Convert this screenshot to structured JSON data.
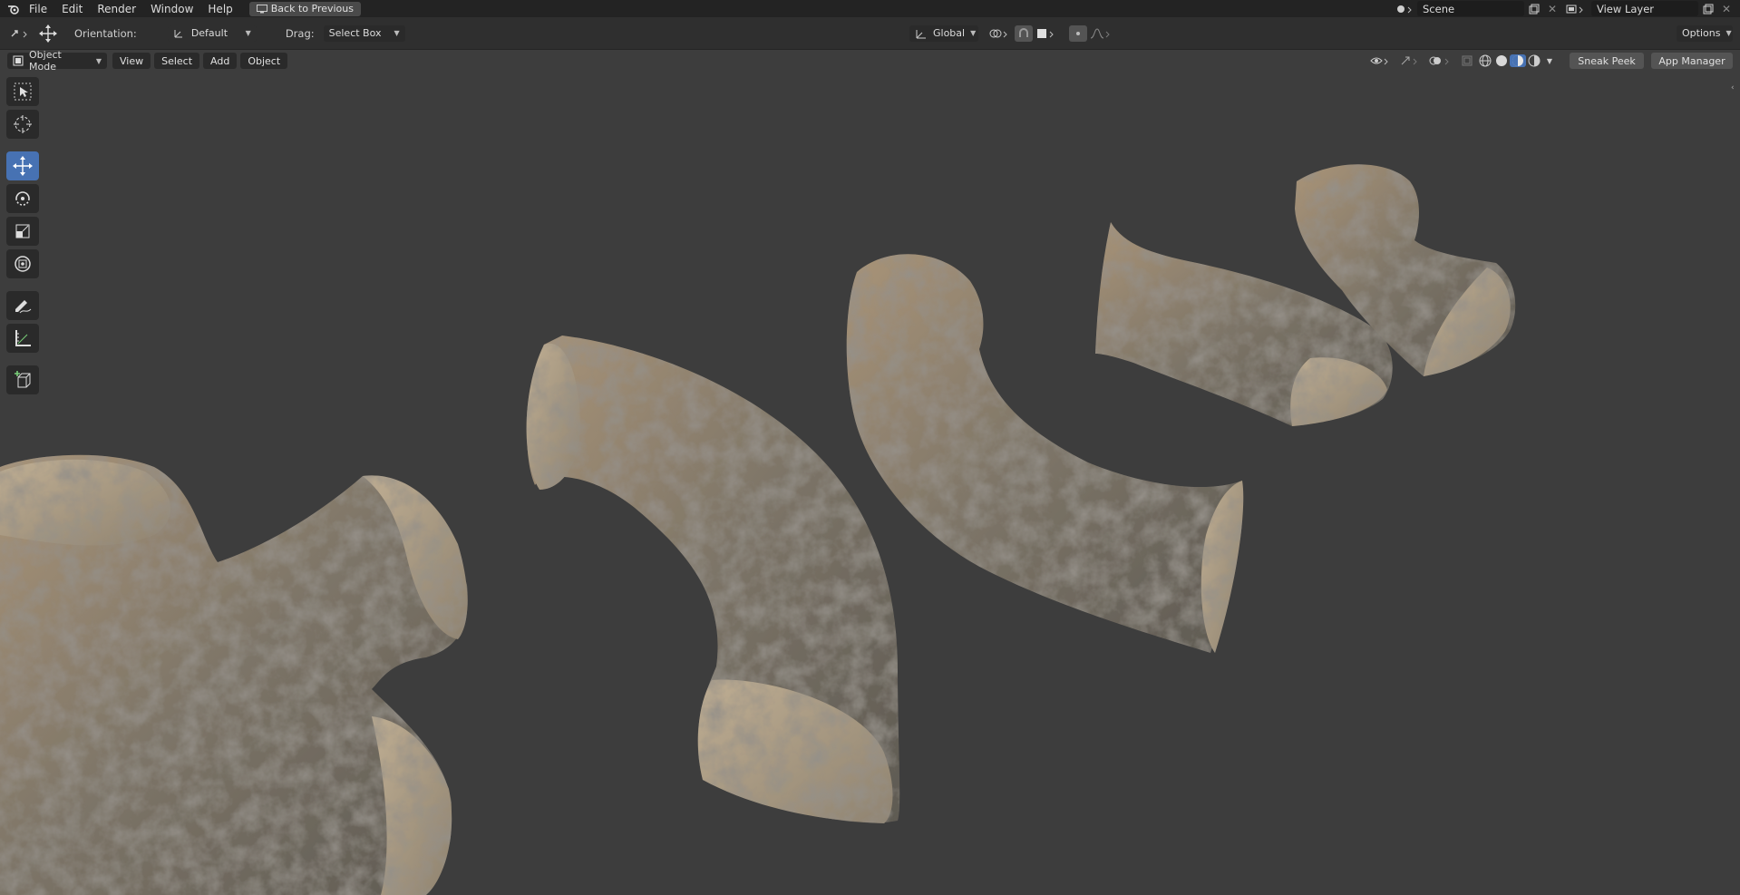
{
  "topbar": {
    "menus": [
      "File",
      "Edit",
      "Render",
      "Window",
      "Help"
    ],
    "back_label": "Back to Previous",
    "scene_value": "Scene",
    "view_layer_value": "View Layer"
  },
  "toolheader": {
    "orientation_label": "Orientation:",
    "orientation_value": "Default",
    "drag_label": "Drag:",
    "drag_value": "Select Box",
    "transform_orientation": "Global",
    "options_label": "Options"
  },
  "viewheader": {
    "mode_value": "Object Mode",
    "menus": [
      "View",
      "Select",
      "Add",
      "Object"
    ],
    "sneak_peek_label": "Sneak Peek",
    "app_manager_label": "App Manager"
  },
  "toolbar": {
    "tools": [
      "select-box",
      "cursor",
      "move",
      "rotate",
      "scale",
      "transform",
      "annotate",
      "measure",
      "add-cube"
    ],
    "active": "move"
  },
  "colors": {
    "active_tool": "#4772b3",
    "viewport_bg": "#3d3d3d",
    "rock_light": "#a8957a",
    "rock_dark": "#4a4640"
  }
}
